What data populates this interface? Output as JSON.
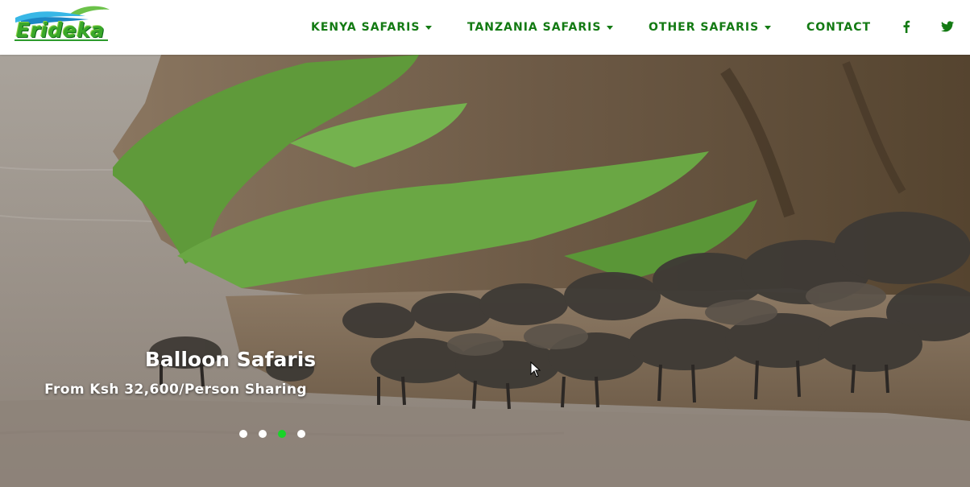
{
  "brand": {
    "logo_text": "Erideka"
  },
  "nav": {
    "items": [
      {
        "label": "KENYA SAFARIS",
        "has_dropdown": true
      },
      {
        "label": "TANZANIA SAFARIS",
        "has_dropdown": true
      },
      {
        "label": "OTHER SAFARIS",
        "has_dropdown": true
      },
      {
        "label": "CONTACT",
        "has_dropdown": false
      }
    ],
    "social": [
      {
        "icon": "facebook-icon"
      },
      {
        "icon": "twitter-icon"
      }
    ]
  },
  "hero": {
    "title": "Balloon Safaris",
    "subtitle": "From Ksh 32,600/Person Sharing",
    "slide_count": 4,
    "active_slide": 3
  },
  "colors": {
    "nav_text": "#137a13",
    "active_dot": "#18d428",
    "logo_green": "#3aa82a"
  }
}
